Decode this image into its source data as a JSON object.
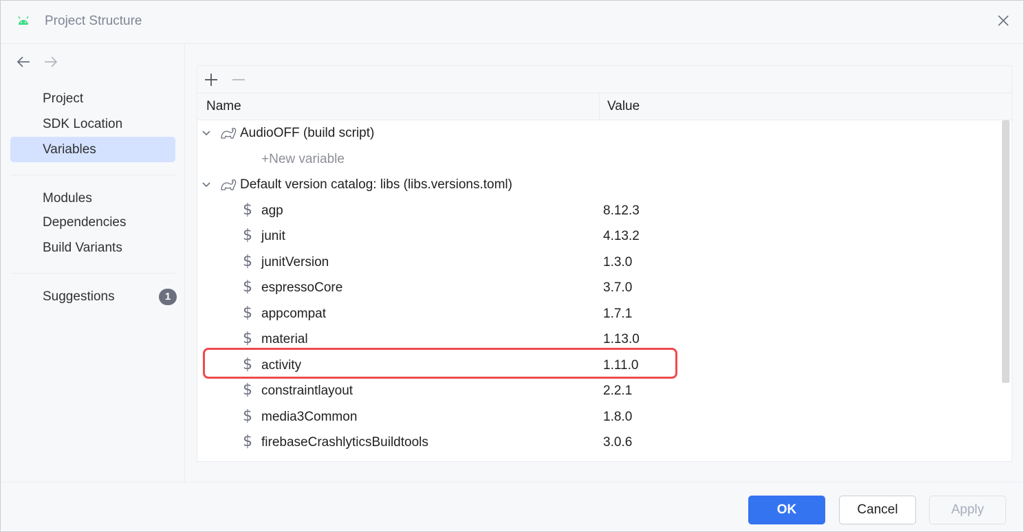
{
  "window": {
    "title": "Project Structure"
  },
  "sidebar": {
    "items": [
      {
        "label": "Project"
      },
      {
        "label": "SDK Location"
      },
      {
        "label": "Variables",
        "selected": true
      },
      {
        "label": "Modules"
      },
      {
        "label": "Dependencies"
      },
      {
        "label": "Build Variants"
      },
      {
        "label": "Suggestions",
        "badge": "1"
      }
    ]
  },
  "table": {
    "columns": {
      "name": "Name",
      "value": "Value"
    },
    "groups": [
      {
        "label": "AudioOFF (build script)",
        "new_variable": "+New variable"
      },
      {
        "label": "Default version catalog: libs (libs.versions.toml)",
        "variables": [
          {
            "name": "agp",
            "value": "8.12.3"
          },
          {
            "name": "junit",
            "value": "4.13.2"
          },
          {
            "name": "junitVersion",
            "value": "1.3.0"
          },
          {
            "name": "espressoCore",
            "value": "3.7.0"
          },
          {
            "name": "appcompat",
            "value": "1.7.1"
          },
          {
            "name": "material",
            "value": "1.13.0"
          },
          {
            "name": "activity",
            "value": "1.11.0",
            "highlighted": true
          },
          {
            "name": "constraintlayout",
            "value": "2.2.1"
          },
          {
            "name": "media3Common",
            "value": "1.8.0"
          },
          {
            "name": "firebaseCrashlyticsBuildtools",
            "value": "3.0.6"
          }
        ]
      }
    ]
  },
  "footer": {
    "ok": "OK",
    "cancel": "Cancel",
    "apply": "Apply"
  },
  "icons": {
    "app": "android-icon",
    "close": "close-icon",
    "back": "arrow-left-icon",
    "forward": "arrow-right-icon",
    "add": "plus-icon",
    "remove": "minus-icon",
    "expand": "chevron-down-icon",
    "gradle": "gradle-icon",
    "variable": "dollar-icon"
  },
  "colors": {
    "accent": "#3574f0",
    "selection": "#d4e2ff",
    "highlight_border": "#ee4b4b",
    "badge": "#6c707e"
  }
}
